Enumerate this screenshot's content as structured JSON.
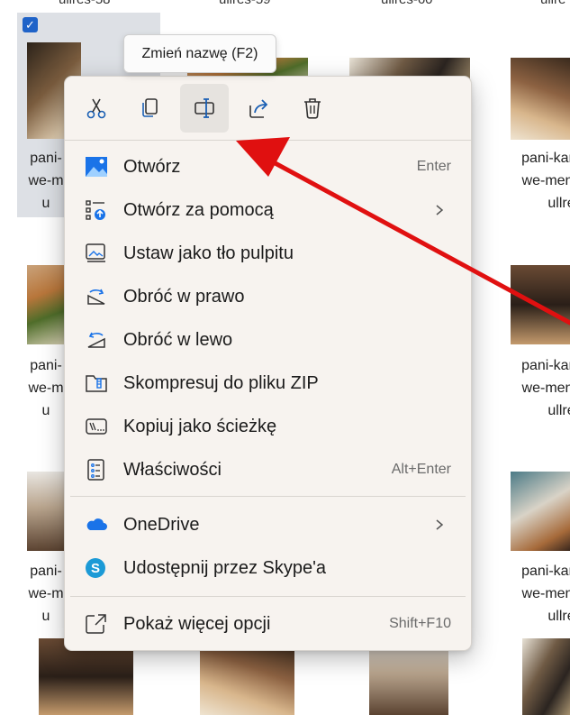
{
  "grid": {
    "top_labels": [
      "ullres-58",
      "ullres-59",
      "ullres-60",
      "ullre"
    ],
    "filename_lines_left": [
      "pani-",
      "we-m",
      "u"
    ],
    "filename_lines_right": [
      "pani-kar",
      "we-men",
      "ullre"
    ],
    "checkbox_checked": true
  },
  "tooltip": {
    "text": "Zmień nazwę (F2)"
  },
  "context_menu": {
    "toolbar": [
      {
        "name": "cut",
        "icon": "scissors-icon"
      },
      {
        "name": "copy",
        "icon": "copy-icon"
      },
      {
        "name": "rename",
        "icon": "rename-icon",
        "active": true
      },
      {
        "name": "share",
        "icon": "share-icon"
      },
      {
        "name": "delete",
        "icon": "trash-icon"
      }
    ],
    "items": [
      {
        "label": "Otwórz",
        "shortcut": "Enter",
        "icon": "image-icon"
      },
      {
        "label": "Otwórz za pomocą",
        "submenu": true,
        "icon": "open-with-icon"
      },
      {
        "label": "Ustaw jako tło pulpitu",
        "icon": "desktop-background-icon"
      },
      {
        "label": "Obróć w prawo",
        "icon": "rotate-right-icon"
      },
      {
        "label": "Obróć w lewo",
        "icon": "rotate-left-icon"
      },
      {
        "label": "Skompresuj do pliku ZIP",
        "icon": "zip-folder-icon"
      },
      {
        "label": "Kopiuj jako ścieżkę",
        "icon": "copy-path-icon"
      },
      {
        "label": "Właściwości",
        "shortcut": "Alt+Enter",
        "icon": "properties-icon"
      },
      {
        "label": "OneDrive",
        "submenu": true,
        "icon": "onedrive-icon"
      },
      {
        "label": "Udostępnij przez Skype'a",
        "icon": "skype-icon"
      },
      {
        "label": "Pokaż więcej opcji",
        "shortcut": "Shift+F10",
        "icon": "show-more-options-icon"
      }
    ]
  },
  "colors": {
    "accent": "#1f63c8",
    "arrow": "#e01010",
    "menu_bg": "#f7f3ef",
    "selection_bg": "#dde0e5",
    "onedrive_blue": "#1a73e8",
    "skype_blue": "#1c9ad6"
  }
}
